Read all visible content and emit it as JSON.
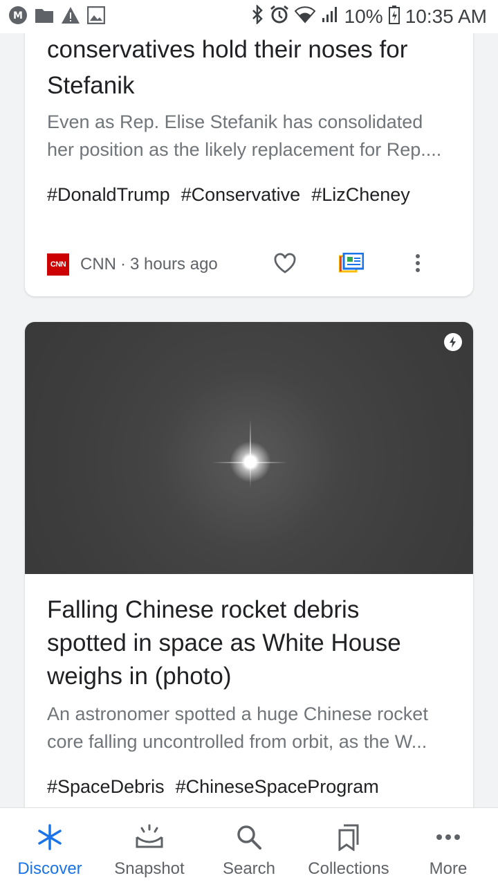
{
  "status_bar": {
    "battery": "10%",
    "time": "10:35 AM"
  },
  "cards": [
    {
      "headline": "conservatives hold their noses for Stefanik",
      "headline_lines": [
        "conservatives hold their noses for",
        "Stefanik"
      ],
      "snippet_lines": [
        "Even as Rep. Elise Stefanik has consolidated",
        "her position as the likely replacement for Rep...."
      ],
      "tags": [
        "#DonaldTrump",
        "#Conservative",
        "#LizCheney"
      ],
      "source": "CNN",
      "source_logo_text": "CNN",
      "time_ago": "3 hours ago"
    },
    {
      "headline_lines": [
        "Falling Chinese rocket debris",
        "spotted in space as White House",
        "weighs in (photo)"
      ],
      "snippet_lines": [
        "An astronomer spotted a huge Chinese rocket",
        "core falling uncontrolled from orbit, as the W..."
      ],
      "tags": [
        "#SpaceDebris",
        "#ChineseSpaceProgram"
      ]
    }
  ],
  "bottom_nav": {
    "items": [
      {
        "label": "Discover",
        "icon": "asterisk-icon",
        "active": true
      },
      {
        "label": "Snapshot",
        "icon": "snapshot-icon",
        "active": false
      },
      {
        "label": "Search",
        "icon": "search-icon",
        "active": false
      },
      {
        "label": "Collections",
        "icon": "bookmarks-icon",
        "active": false
      },
      {
        "label": "More",
        "icon": "more-horiz-icon",
        "active": false
      }
    ]
  },
  "colors": {
    "accent": "#1a73e8",
    "cnn_red": "#cc0000",
    "text_secondary": "#70757a"
  }
}
